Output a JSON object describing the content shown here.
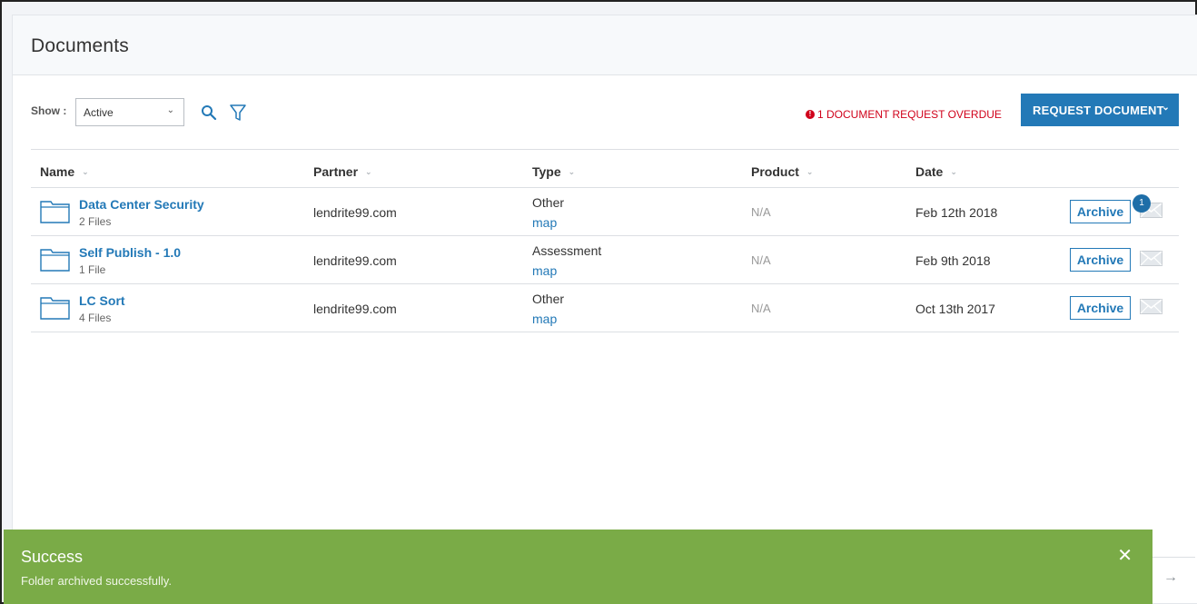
{
  "panel": {
    "title": "Documents"
  },
  "toolbar": {
    "show_label": "Show :",
    "show_value": "Active",
    "overdue_text": "1 DOCUMENT REQUEST OVERDUE",
    "overdue_icon": "!",
    "request_button": "REQUEST DOCUMENT"
  },
  "table": {
    "columns": [
      "Name",
      "Partner",
      "Type",
      "Product",
      "Date"
    ],
    "rows": [
      {
        "name": "Data Center Security",
        "files": "2 Files",
        "partner": "lendrite99.com",
        "type": "Other",
        "type_link": "map",
        "product": "N/A",
        "date": "Feb 12th 2018",
        "action": "Archive",
        "badge": "1"
      },
      {
        "name": "Self Publish - 1.0",
        "files": "1 File",
        "partner": "lendrite99.com",
        "type": "Assessment",
        "type_link": "map",
        "product": "N/A",
        "date": "Feb 9th 2018",
        "action": "Archive"
      },
      {
        "name": "LC Sort",
        "files": "4 Files",
        "partner": "lendrite99.com",
        "type": "Other",
        "type_link": "map",
        "product": "N/A",
        "date": "Oct 13th 2017",
        "action": "Archive"
      }
    ]
  },
  "toast": {
    "title": "Success",
    "message": "Folder archived successfully.",
    "close": "✕"
  },
  "pager": {
    "next": "→"
  },
  "colors": {
    "primary": "#2379b7",
    "success": "#7aab47",
    "danger": "#d0021b"
  }
}
